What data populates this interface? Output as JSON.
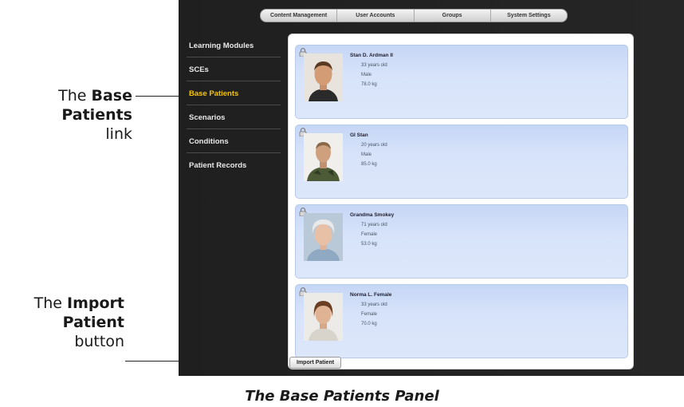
{
  "top_nav": {
    "tabs": [
      "Content Management",
      "User Accounts",
      "Groups",
      "System Settings"
    ]
  },
  "sidebar": {
    "items": [
      {
        "label": "Learning Modules",
        "active": false
      },
      {
        "label": "SCEs",
        "active": false
      },
      {
        "label": "Base Patients",
        "active": true
      },
      {
        "label": "Scenarios",
        "active": false
      },
      {
        "label": "Conditions",
        "active": false
      },
      {
        "label": "Patient Records",
        "active": false
      }
    ]
  },
  "patients": [
    {
      "name": "Stan D. Ardman II",
      "age": "33 years old",
      "sex": "Male",
      "weight": "78.0 kg",
      "photo": "young-man-photo"
    },
    {
      "name": "GI Stan",
      "age": "20 years old",
      "sex": "Male",
      "weight": "85.0 kg",
      "photo": "soldier-photo"
    },
    {
      "name": "Grandma Smokey",
      "age": "71 years old",
      "sex": "Female",
      "weight": "53.0 kg",
      "photo": "elderly-woman-photo"
    },
    {
      "name": "Norma L. Female",
      "age": "33 years old",
      "sex": "Female",
      "weight": "70.0 kg",
      "photo": "woman-photo"
    }
  ],
  "import_button": {
    "label": "Import Patient"
  },
  "callouts": {
    "base_patients": {
      "pre": "The ",
      "bold1": "Base",
      "bold2": "Patients",
      "post": "link"
    },
    "import_patient": {
      "pre": "The ",
      "bold1": "Import",
      "bold2": "Patient",
      "post": "button"
    }
  },
  "caption": "The Base Patients Panel",
  "colors": {
    "active_sidebar": "#f5c400",
    "card_bg": "#d7e3fa",
    "app_bg": "#222222"
  }
}
